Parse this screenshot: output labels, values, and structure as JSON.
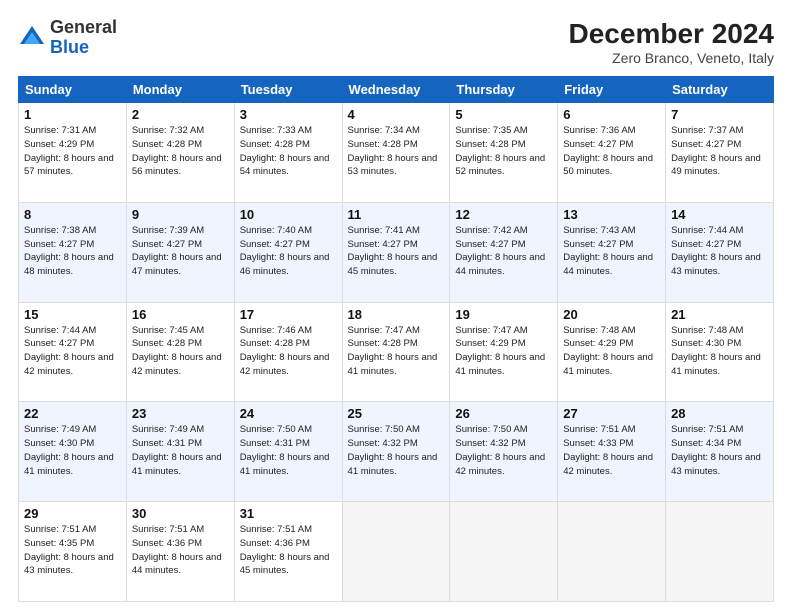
{
  "header": {
    "logo": {
      "general": "General",
      "blue": "Blue"
    },
    "title": "December 2024",
    "subtitle": "Zero Branco, Veneto, Italy"
  },
  "columns": [
    "Sunday",
    "Monday",
    "Tuesday",
    "Wednesday",
    "Thursday",
    "Friday",
    "Saturday"
  ],
  "weeks": [
    [
      {
        "day": "1",
        "sunrise": "Sunrise: 7:31 AM",
        "sunset": "Sunset: 4:29 PM",
        "daylight": "Daylight: 8 hours and 57 minutes."
      },
      {
        "day": "2",
        "sunrise": "Sunrise: 7:32 AM",
        "sunset": "Sunset: 4:28 PM",
        "daylight": "Daylight: 8 hours and 56 minutes."
      },
      {
        "day": "3",
        "sunrise": "Sunrise: 7:33 AM",
        "sunset": "Sunset: 4:28 PM",
        "daylight": "Daylight: 8 hours and 54 minutes."
      },
      {
        "day": "4",
        "sunrise": "Sunrise: 7:34 AM",
        "sunset": "Sunset: 4:28 PM",
        "daylight": "Daylight: 8 hours and 53 minutes."
      },
      {
        "day": "5",
        "sunrise": "Sunrise: 7:35 AM",
        "sunset": "Sunset: 4:28 PM",
        "daylight": "Daylight: 8 hours and 52 minutes."
      },
      {
        "day": "6",
        "sunrise": "Sunrise: 7:36 AM",
        "sunset": "Sunset: 4:27 PM",
        "daylight": "Daylight: 8 hours and 50 minutes."
      },
      {
        "day": "7",
        "sunrise": "Sunrise: 7:37 AM",
        "sunset": "Sunset: 4:27 PM",
        "daylight": "Daylight: 8 hours and 49 minutes."
      }
    ],
    [
      {
        "day": "8",
        "sunrise": "Sunrise: 7:38 AM",
        "sunset": "Sunset: 4:27 PM",
        "daylight": "Daylight: 8 hours and 48 minutes."
      },
      {
        "day": "9",
        "sunrise": "Sunrise: 7:39 AM",
        "sunset": "Sunset: 4:27 PM",
        "daylight": "Daylight: 8 hours and 47 minutes."
      },
      {
        "day": "10",
        "sunrise": "Sunrise: 7:40 AM",
        "sunset": "Sunset: 4:27 PM",
        "daylight": "Daylight: 8 hours and 46 minutes."
      },
      {
        "day": "11",
        "sunrise": "Sunrise: 7:41 AM",
        "sunset": "Sunset: 4:27 PM",
        "daylight": "Daylight: 8 hours and 45 minutes."
      },
      {
        "day": "12",
        "sunrise": "Sunrise: 7:42 AM",
        "sunset": "Sunset: 4:27 PM",
        "daylight": "Daylight: 8 hours and 44 minutes."
      },
      {
        "day": "13",
        "sunrise": "Sunrise: 7:43 AM",
        "sunset": "Sunset: 4:27 PM",
        "daylight": "Daylight: 8 hours and 44 minutes."
      },
      {
        "day": "14",
        "sunrise": "Sunrise: 7:44 AM",
        "sunset": "Sunset: 4:27 PM",
        "daylight": "Daylight: 8 hours and 43 minutes."
      }
    ],
    [
      {
        "day": "15",
        "sunrise": "Sunrise: 7:44 AM",
        "sunset": "Sunset: 4:27 PM",
        "daylight": "Daylight: 8 hours and 42 minutes."
      },
      {
        "day": "16",
        "sunrise": "Sunrise: 7:45 AM",
        "sunset": "Sunset: 4:28 PM",
        "daylight": "Daylight: 8 hours and 42 minutes."
      },
      {
        "day": "17",
        "sunrise": "Sunrise: 7:46 AM",
        "sunset": "Sunset: 4:28 PM",
        "daylight": "Daylight: 8 hours and 42 minutes."
      },
      {
        "day": "18",
        "sunrise": "Sunrise: 7:47 AM",
        "sunset": "Sunset: 4:28 PM",
        "daylight": "Daylight: 8 hours and 41 minutes."
      },
      {
        "day": "19",
        "sunrise": "Sunrise: 7:47 AM",
        "sunset": "Sunset: 4:29 PM",
        "daylight": "Daylight: 8 hours and 41 minutes."
      },
      {
        "day": "20",
        "sunrise": "Sunrise: 7:48 AM",
        "sunset": "Sunset: 4:29 PM",
        "daylight": "Daylight: 8 hours and 41 minutes."
      },
      {
        "day": "21",
        "sunrise": "Sunrise: 7:48 AM",
        "sunset": "Sunset: 4:30 PM",
        "daylight": "Daylight: 8 hours and 41 minutes."
      }
    ],
    [
      {
        "day": "22",
        "sunrise": "Sunrise: 7:49 AM",
        "sunset": "Sunset: 4:30 PM",
        "daylight": "Daylight: 8 hours and 41 minutes."
      },
      {
        "day": "23",
        "sunrise": "Sunrise: 7:49 AM",
        "sunset": "Sunset: 4:31 PM",
        "daylight": "Daylight: 8 hours and 41 minutes."
      },
      {
        "day": "24",
        "sunrise": "Sunrise: 7:50 AM",
        "sunset": "Sunset: 4:31 PM",
        "daylight": "Daylight: 8 hours and 41 minutes."
      },
      {
        "day": "25",
        "sunrise": "Sunrise: 7:50 AM",
        "sunset": "Sunset: 4:32 PM",
        "daylight": "Daylight: 8 hours and 41 minutes."
      },
      {
        "day": "26",
        "sunrise": "Sunrise: 7:50 AM",
        "sunset": "Sunset: 4:32 PM",
        "daylight": "Daylight: 8 hours and 42 minutes."
      },
      {
        "day": "27",
        "sunrise": "Sunrise: 7:51 AM",
        "sunset": "Sunset: 4:33 PM",
        "daylight": "Daylight: 8 hours and 42 minutes."
      },
      {
        "day": "28",
        "sunrise": "Sunrise: 7:51 AM",
        "sunset": "Sunset: 4:34 PM",
        "daylight": "Daylight: 8 hours and 43 minutes."
      }
    ],
    [
      {
        "day": "29",
        "sunrise": "Sunrise: 7:51 AM",
        "sunset": "Sunset: 4:35 PM",
        "daylight": "Daylight: 8 hours and 43 minutes."
      },
      {
        "day": "30",
        "sunrise": "Sunrise: 7:51 AM",
        "sunset": "Sunset: 4:36 PM",
        "daylight": "Daylight: 8 hours and 44 minutes."
      },
      {
        "day": "31",
        "sunrise": "Sunrise: 7:51 AM",
        "sunset": "Sunset: 4:36 PM",
        "daylight": "Daylight: 8 hours and 45 minutes."
      },
      null,
      null,
      null,
      null
    ]
  ]
}
